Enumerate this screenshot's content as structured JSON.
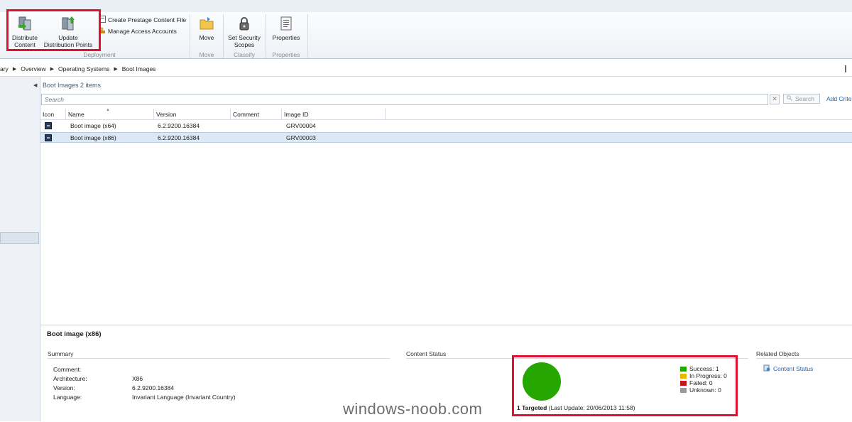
{
  "ribbon": {
    "distribute_content": "Distribute\nContent",
    "update_dp": "Update\nDistribution Points",
    "create_prestage": "Create Prestage Content File",
    "manage_access": "Manage Access Accounts",
    "group_deployment": "Deployment",
    "move": "Move",
    "group_move": "Move",
    "set_security": "Set Security\nScopes",
    "group_classify": "Classify",
    "properties": "Properties",
    "group_properties": "Properties"
  },
  "breadcrumb": [
    "ary",
    "Overview",
    "Operating Systems",
    "Boot Images"
  ],
  "content": {
    "title": "Boot Images 2 items",
    "search_placeholder": "Search",
    "search_button": "Search",
    "add_criteria": "Add Crite"
  },
  "grid": {
    "columns": [
      "Icon",
      "Name",
      "Version",
      "Comment",
      "Image ID"
    ],
    "rows": [
      {
        "name": "Boot image (x64)",
        "version": "6.2.9200.16384",
        "comment": "",
        "image_id": "GRV00004"
      },
      {
        "name": "Boot image (x86)",
        "version": "6.2.9200.16384",
        "comment": "",
        "image_id": "GRV00003"
      }
    ]
  },
  "details": {
    "title": "Boot image (x86)",
    "summary_header": "Summary",
    "content_status_header": "Content Status",
    "related_header": "Related Objects",
    "props": [
      {
        "label": "Comment:",
        "value": ""
      },
      {
        "label": "Architecture:",
        "value": "X86"
      },
      {
        "label": "Version:",
        "value": "6.2.9200.16384"
      },
      {
        "label": "Language:",
        "value": "Invariant Language (Invariant Country)"
      }
    ],
    "legend": [
      {
        "label": "Success: 1",
        "color": "#26a600"
      },
      {
        "label": "In Progress: 0",
        "color": "#e8b800"
      },
      {
        "label": "Failed: 0",
        "color": "#c8141e"
      },
      {
        "label": "Unknown: 0",
        "color": "#9a9a9a"
      }
    ],
    "targeted": "1 Targeted",
    "last_update": "(Last Update: 20/06/2013 11:58)",
    "related_link": "Content Status"
  },
  "watermark": "windows-noob.com"
}
